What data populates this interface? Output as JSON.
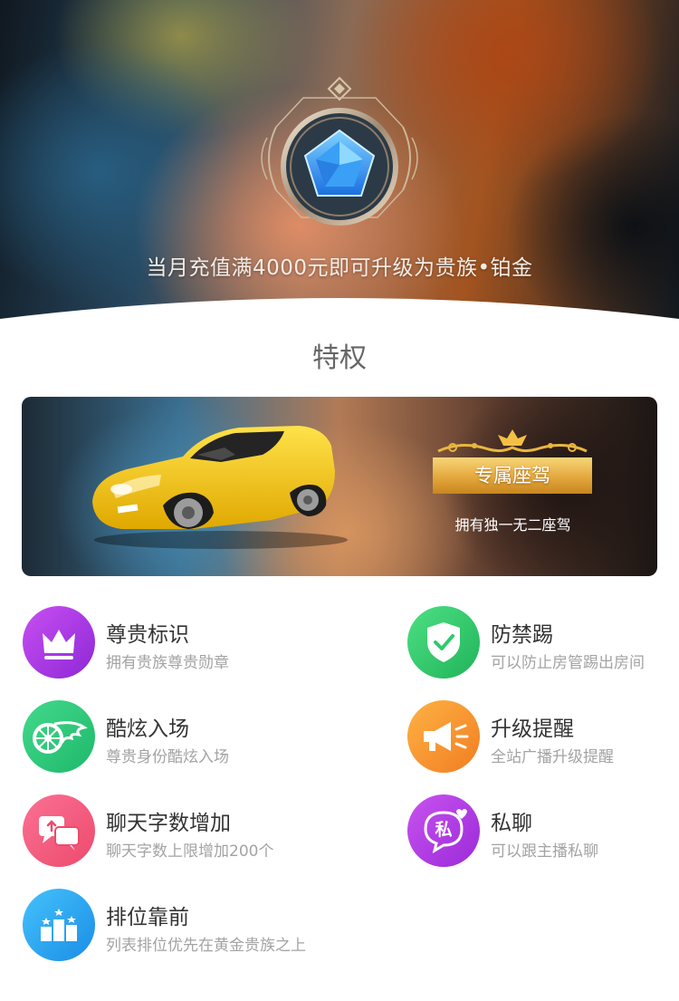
{
  "hero": {
    "text": "当月充值满4000元即可升级为贵族•铂金"
  },
  "privileges": {
    "title": "特权",
    "banner": {
      "label": "专属座驾",
      "subtitle": "拥有独一无二座驾"
    },
    "items": [
      {
        "icon": "crown-icon",
        "title": "尊贵标识",
        "desc": "拥有贵族尊贵勋章",
        "color": "#a934e8"
      },
      {
        "icon": "shield-check-icon",
        "title": "防禁踢",
        "desc": "可以防止房管踢出房间",
        "color": "#2ecb6d"
      },
      {
        "icon": "flaming-wheel-icon",
        "title": "酷炫入场",
        "desc": "尊贵身份酷炫入场",
        "color": "#2bc57c"
      },
      {
        "icon": "megaphone-icon",
        "title": "升级提醒",
        "desc": "全站广播升级提醒",
        "color": "#f7922c"
      },
      {
        "icon": "chat-bubbles-icon",
        "title": "聊天字数增加",
        "desc": "聊天字数上限增加200个",
        "color": "#f25b7c"
      },
      {
        "icon": "private-chat-icon",
        "title": "私聊",
        "desc": "可以跟主播私聊",
        "color": "#b23ae0",
        "badge": "私"
      },
      {
        "icon": "ranking-podium-icon",
        "title": "排位靠前",
        "desc": "列表排位优先在黄金贵族之上",
        "color": "#2da4ec"
      }
    ]
  }
}
